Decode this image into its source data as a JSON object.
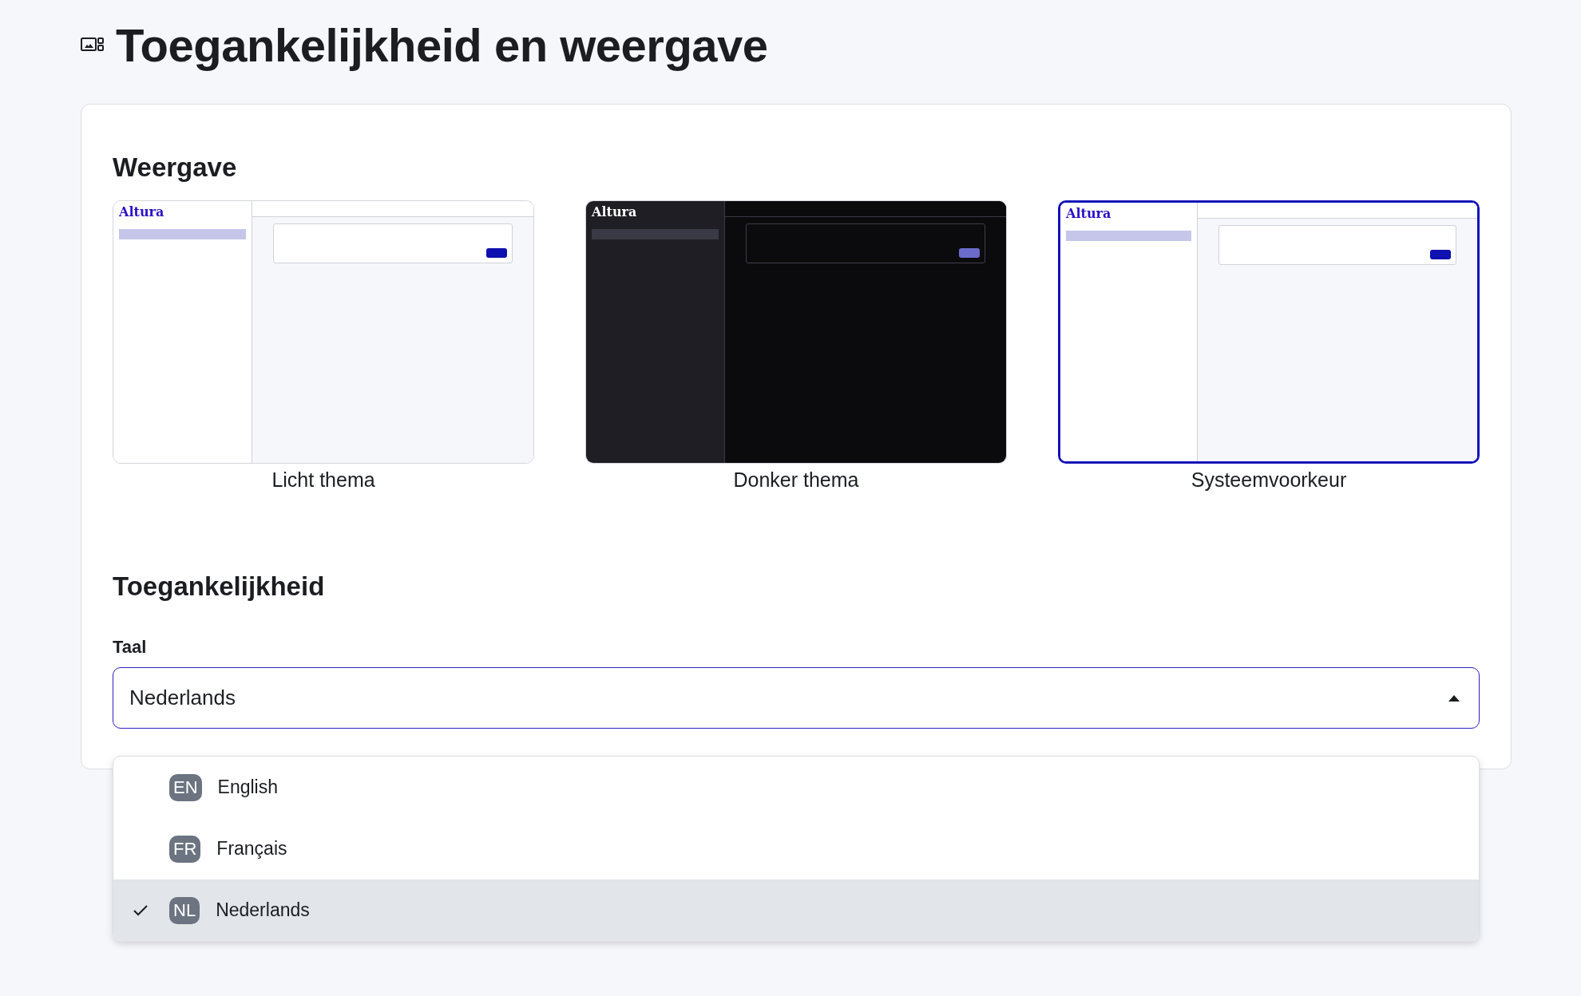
{
  "page": {
    "title": "Toegankelijkheid en weergave"
  },
  "appearance": {
    "heading": "Weergave",
    "themes": [
      {
        "label": "Licht thema",
        "kind": "light",
        "logo": "Altura",
        "selected": false
      },
      {
        "label": "Donker thema",
        "kind": "dark",
        "logo": "Altura",
        "selected": false
      },
      {
        "label": "Systeemvoorkeur",
        "kind": "light",
        "logo": "Altura",
        "selected": true
      }
    ]
  },
  "accessibility": {
    "heading": "Toegankelijkheid",
    "language_label": "Taal",
    "language_select": {
      "value": "Nederlands",
      "expanded": true
    },
    "options": [
      {
        "code": "EN",
        "name": "English",
        "selected": false
      },
      {
        "code": "FR",
        "name": "Français",
        "selected": false
      },
      {
        "code": "NL",
        "name": "Nederlands",
        "selected": true
      }
    ]
  }
}
